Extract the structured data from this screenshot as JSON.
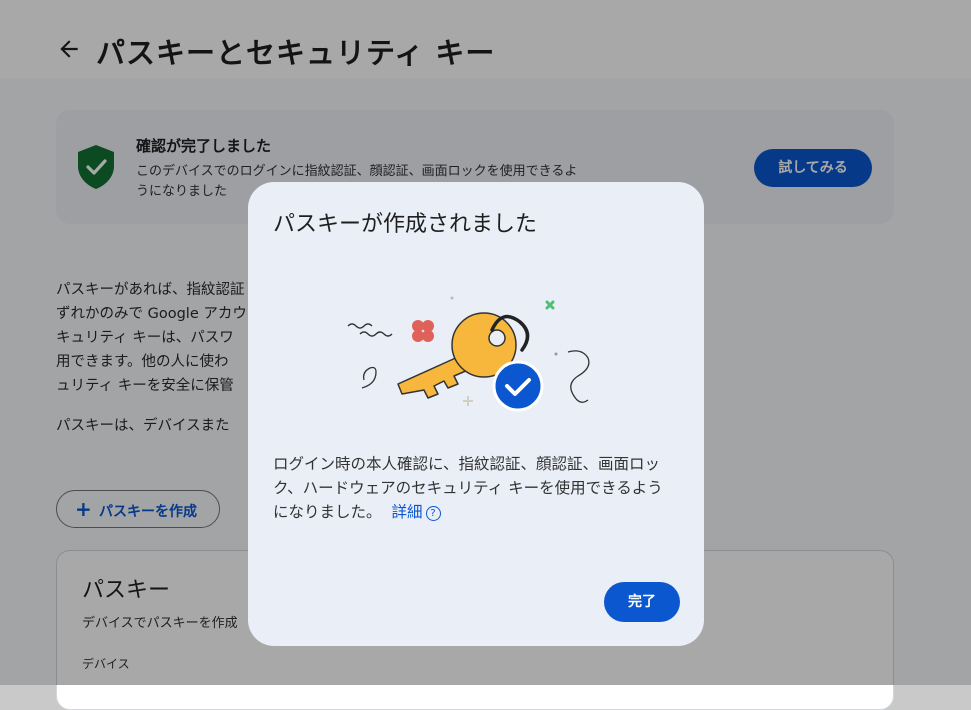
{
  "header": {
    "title": "パスキーとセキュリティ キー",
    "back_icon": "arrow-left-icon"
  },
  "verify_card": {
    "title": "確認が完了しました",
    "text_line1": "このデバイスでのログインに指紋認証、顔認証、画面ロックを使用できるよ",
    "text_line2": "うになりました",
    "try_button": "試してみる",
    "icon": "shield-check-icon"
  },
  "intro": {
    "lines": [
      "パスキーがあれば、指紋認証",
      "ずれかのみで Google アカウ",
      "キュリティ キーは、パスワ",
      "用できます。他の人に使わ",
      "ュリティ キーを安全に保管"
    ],
    "line2": "パスキーは、デバイスまた"
  },
  "create_button": {
    "label": "パスキーを作成",
    "icon": "plus-icon"
  },
  "passkeys_card": {
    "title": "パスキー",
    "subtitle": "デバイスでパスキーを作成",
    "device_label": "デバイス"
  },
  "dialog": {
    "title": "パスキーが作成されました",
    "body_line1": "ログイン時の本人確認に、指紋認証、顔認証、画面ロッ",
    "body_line2": "ク、ハードウェアのセキュリティ キーを使用できるよう",
    "body_line3": "になりました。",
    "link": "詳細",
    "help_glyph": "?",
    "done_button": "完了",
    "illustration": "key-with-checkmark-icon"
  },
  "colors": {
    "accent": "#0b57d0",
    "shield": "#137333",
    "key": "#f6b73c",
    "dialog_bg": "#e9eef7"
  }
}
